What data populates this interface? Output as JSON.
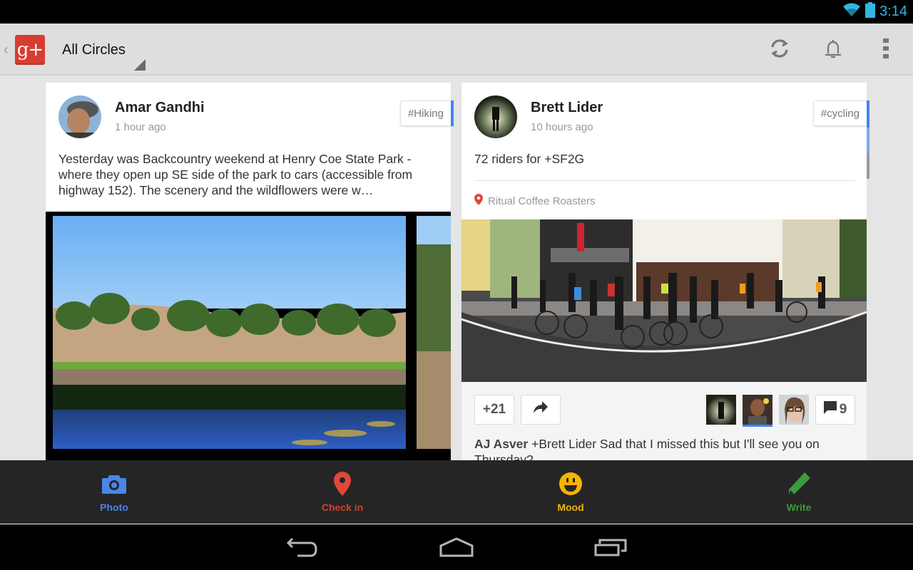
{
  "status_bar": {
    "time": "3:14",
    "icons": [
      "wifi-icon",
      "battery-icon"
    ]
  },
  "action_bar": {
    "app": "Google+",
    "logo_text": "g+",
    "up_caret": "‹",
    "spinner_label": "All Circles",
    "actions": [
      {
        "name": "refresh",
        "icon": "refresh-icon"
      },
      {
        "name": "notifications",
        "icon": "bell-icon"
      },
      {
        "name": "overflow",
        "icon": "overflow-menu-icon"
      }
    ]
  },
  "posts": [
    {
      "author": "Amar Gandhi",
      "time": "1 hour ago",
      "hashtag": "#Hiking",
      "text": "Yesterday was Backcountry weekend at Henry Coe State Park - where they open up SE side of the park to cars (accessible from highway 152).  The scenery and the wildflowers were w…",
      "photo_description": "Pond reflecting oak trees on dry golden hills under blue sky"
    },
    {
      "author": "Brett Lider",
      "time": "10 hours ago",
      "hashtag": "#cycling",
      "text": "72 riders for +SF2G",
      "location": "Ritual Coffee Roasters",
      "photo_description": "Panorama of cyclists gathered at a street corner coffee shop",
      "plus_count": "+21",
      "comment_count": "9",
      "comment": {
        "author": "AJ Asver",
        "text": "+Brett Lider  Sad that I missed this but I'll see you on Thursday?"
      }
    }
  ],
  "bottom_bar": {
    "items": [
      {
        "label": "Photo",
        "icon": "camera-icon",
        "color": "#4a86e8"
      },
      {
        "label": "Check in",
        "icon": "location-pin-icon",
        "color": "#d2402f"
      },
      {
        "label": "Mood",
        "icon": "smiley-icon",
        "color": "#f4b400"
      },
      {
        "label": "Write",
        "icon": "pencil-icon",
        "color": "#3d9a3d"
      }
    ]
  },
  "nav_bar": {
    "buttons": [
      "back",
      "home",
      "recent-apps"
    ]
  },
  "colors": {
    "accent": "#4285f4",
    "status_text": "#33b5e5",
    "gplus_red": "#d73d32"
  }
}
